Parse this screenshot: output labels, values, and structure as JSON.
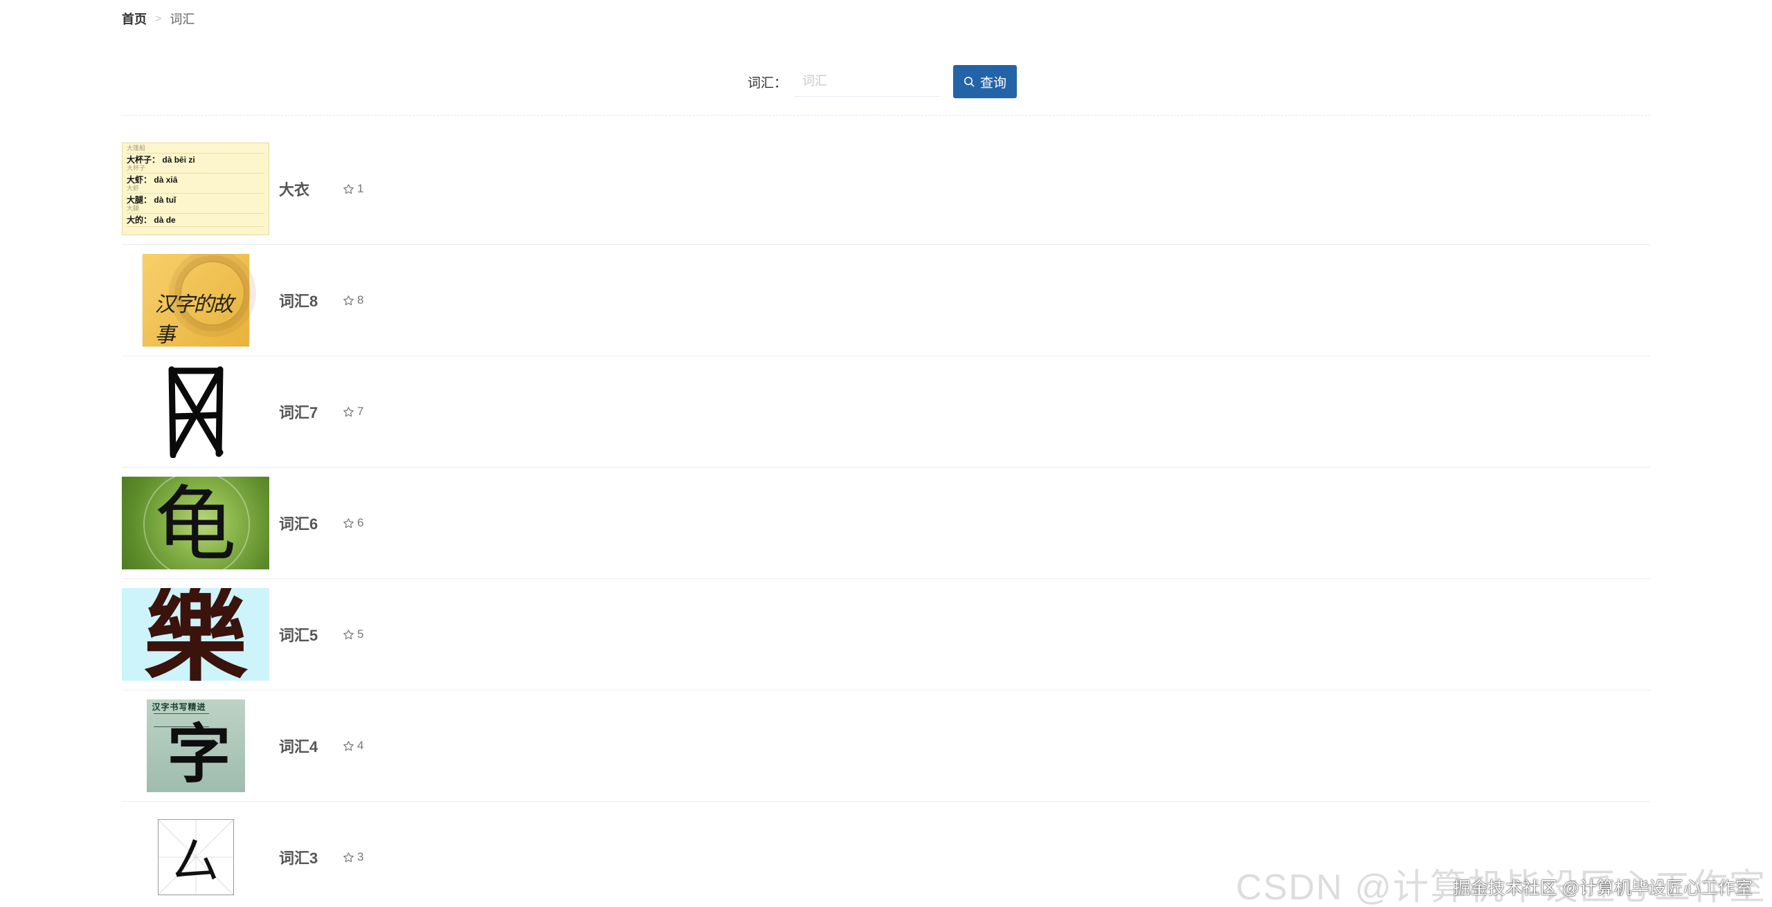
{
  "breadcrumb": {
    "home": "首页",
    "separator": ">",
    "current": "词汇"
  },
  "search": {
    "label": "词汇：",
    "placeholder": "词汇",
    "value": "",
    "button_label": "查询",
    "button_icon": "search-icon",
    "accent_color": "#2364a8"
  },
  "items": [
    {
      "title": "大衣",
      "favorites": "1",
      "thumbnail": "pinyin-card",
      "pinyin_rows": [
        {
          "word": "大杯子：",
          "pinyin": "dà bēi zi",
          "sub": "大杯子"
        },
        {
          "word": "大虾：",
          "pinyin": "dà xiā",
          "sub": "大虾"
        },
        {
          "word": "大腿：",
          "pinyin": "dà tuǐ",
          "sub": "大腿"
        },
        {
          "word": "大的：",
          "pinyin": "dà de",
          "sub": ""
        }
      ],
      "pinyin_top_sub": "大篷船"
    },
    {
      "title": "词汇8",
      "favorites": "8",
      "thumbnail": "book-cover",
      "cover_text": "汉字的故事"
    },
    {
      "title": "词汇7",
      "favorites": "7",
      "thumbnail": "seal-character"
    },
    {
      "title": "词汇6",
      "favorites": "6",
      "thumbnail": "turtle-character",
      "glyph": "龟"
    },
    {
      "title": "词汇5",
      "favorites": "5",
      "thumbnail": "music-character",
      "glyph": "樂"
    },
    {
      "title": "词汇4",
      "favorites": "4",
      "thumbnail": "book-cover-2",
      "cover_text": "汉字书写精进",
      "glyph": "字"
    },
    {
      "title": "词汇3",
      "favorites": "3",
      "thumbnail": "grid-character",
      "glyph": "厶"
    }
  ],
  "star_icon": "star-outline-icon",
  "watermark": {
    "faint": "CSDN @计算机毕设匠心工作室",
    "text": "掘金技术社区 @计算机毕设匠心工作室"
  }
}
